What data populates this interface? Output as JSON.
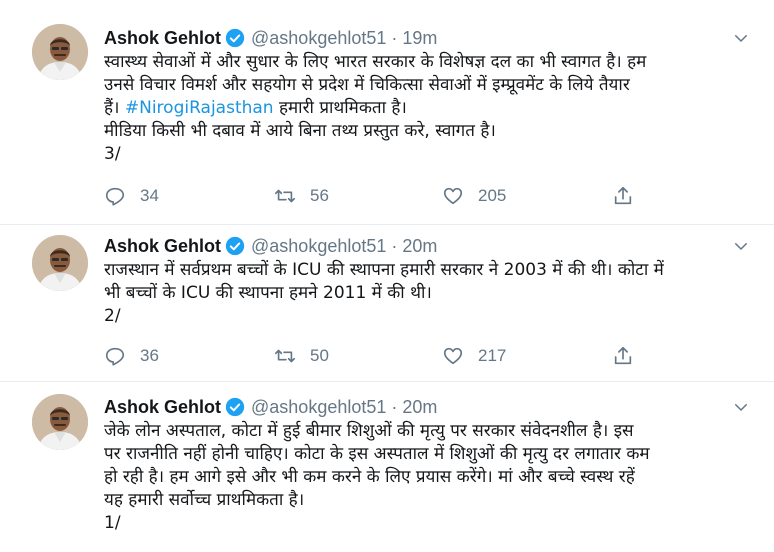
{
  "tweets": [
    {
      "author_name": "Ashok Gehlot",
      "handle": "@ashokgehlot51",
      "separator": "·",
      "time": "19m",
      "text_before_hashtag": "स्वास्थ्य सेवाओं में और सुधार के लिए भारत सरकार के विशेषज्ञ दल का भी स्वागत है। हम",
      "line2": "उनसे विचार विमर्श और सहयोग से प्रदेश में चिकित्सा सेवाओं में इम्प्रूवमेंट के लिये तैयार",
      "line3_prefix": "हैं। ",
      "hashtag": "#NirogiRajasthan",
      "line3_suffix": " हमारी प्राथमिकता है।",
      "line4": "मीडिया किसी भी दबाव में आये बिना तथ्य प्रस्तुत करे, स्वागत है।",
      "thread_marker": "3/",
      "replies": "34",
      "retweets": "56",
      "likes": "205"
    },
    {
      "author_name": "Ashok Gehlot",
      "handle": "@ashokgehlot51",
      "separator": "·",
      "time": "20m",
      "line1": "राजस्थान में सर्वप्रथम बच्चों के ICU की स्थापना हमारी सरकार ने 2003 में की थी। कोटा में",
      "line2": "भी बच्चों के ICU की स्थापना हमने 2011 में की थी।",
      "thread_marker": "2/",
      "replies": "36",
      "retweets": "50",
      "likes": "217"
    },
    {
      "author_name": "Ashok Gehlot",
      "handle": "@ashokgehlot51",
      "separator": "·",
      "time": "20m",
      "line1": "जेके लोन अस्पताल, कोटा में हुई बीमार शिशुओं की मृत्यु पर सरकार संवेदनशील है। इस",
      "line2": "पर राजनीति नहीं होनी चाहिए। कोटा के इस अस्पताल में शिशुओं की मृत्यु दर लगातार कम",
      "line3": "हो रही है। हम आगे इसे और भी कम करने के लिए प्रयास करेंगे। मां और बच्चे स्वस्थ रहें",
      "line4": "यह हमारी सर्वोच्च प्राथमिकता है।",
      "thread_marker": "1/"
    }
  ],
  "colors": {
    "accent": "#1da1f2",
    "hashtag": "#1b95e0",
    "muted": "#657786",
    "divider": "#e6ecf0"
  },
  "icons": [
    "verified-badge-icon",
    "chevron-down-icon",
    "reply-icon",
    "retweet-icon",
    "like-icon",
    "share-icon"
  ]
}
